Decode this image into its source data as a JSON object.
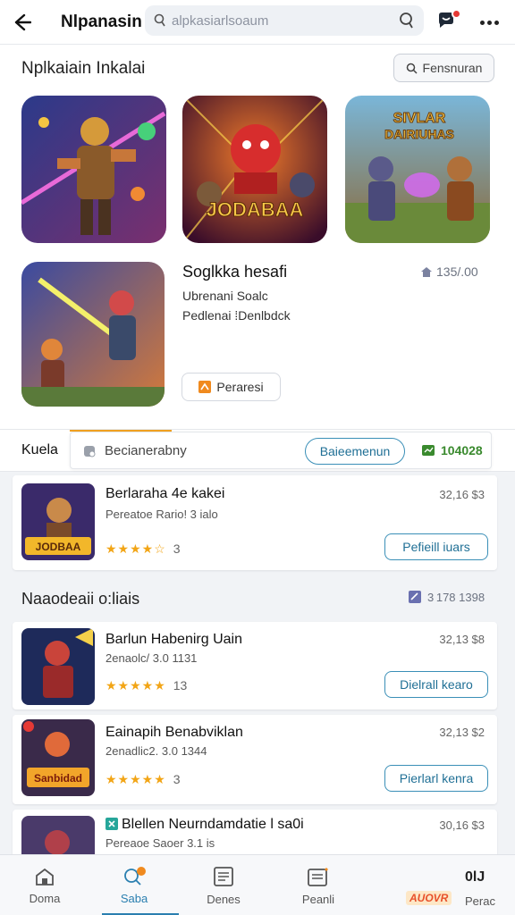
{
  "header": {
    "title": "Nlpanasin",
    "search_placeholder": "alpkasiarlsoaum"
  },
  "featured": {
    "title": "Nplkaiain Inkalai",
    "filter_label": "Fensnuran",
    "tile3_text": "SIVLAR DAIRIUHAS",
    "tile2_text": "JODABAA",
    "main": {
      "name": "Soglkka hesafi",
      "line1": "Ubrenani Soalc",
      "line2": "Pedlenai ⁞Denlbdck",
      "price": "135/.00",
      "install_label": "Peraresi"
    }
  },
  "strip": {
    "label": "Kuela",
    "field_text": "Becianerabny",
    "button_label": "Baieemenun",
    "count": "104028"
  },
  "list1": [
    {
      "name": "Berlaraha 4e kakei",
      "dev": "Pereatoe Rario! 3 ialo",
      "stars": "★★★★☆",
      "rating_count": "3",
      "size": "32,16 $3",
      "action": "Pefieill iuars"
    }
  ],
  "section2": {
    "title": "Naaodeaii o:liais",
    "meta": "3 178 1398"
  },
  "list2": [
    {
      "name": "Barlun Habenirg Uain",
      "dev": "2enaolc/ 3.0 1131",
      "stars": "★★★★★",
      "rating_count": "13",
      "size": "32,13 $8",
      "action": "Dielrall kearo"
    },
    {
      "name": "Eainapih Benabviklan",
      "dev": "2enadlic2. 3.0 1344",
      "stars": "★★★★★",
      "rating_count": "3",
      "size": "32,13 $2",
      "action": "Pierlarl kenra"
    },
    {
      "name": "Blellen Neurndamdatie l sa0i",
      "dev": "Pereaoe Saoer 3.1 is",
      "stars": "",
      "rating_count": "",
      "size": "30,16 $3",
      "action": ""
    }
  ],
  "bottom_nav": [
    {
      "label": "Doma"
    },
    {
      "label": "Saba"
    },
    {
      "label": "Denes"
    },
    {
      "label": "Peanli"
    },
    {
      "label": "Perac"
    }
  ],
  "ad_badge": "AUOVR",
  "ad_top": "0lJ",
  "colors": {
    "accent": "#2a7fb0",
    "star": "#f2a516",
    "price_green": "#3a8a2e"
  }
}
